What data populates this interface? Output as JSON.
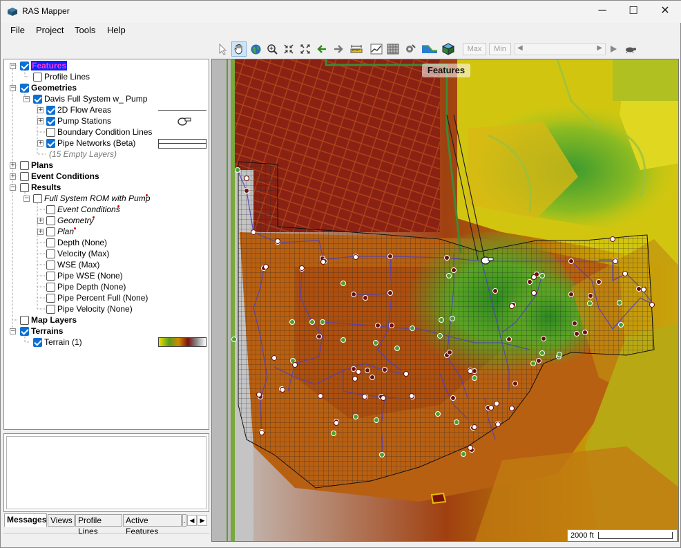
{
  "window": {
    "title": "RAS Mapper",
    "controls": {
      "minimize": "─",
      "maximize": "☐",
      "close": "✕"
    }
  },
  "menu": [
    "File",
    "Project",
    "Tools",
    "Help"
  ],
  "toolbar": {
    "max_label": "Max",
    "min_label": "Min",
    "icons": [
      "select-arrow-icon",
      "pan-hand-icon",
      "globe-icon",
      "zoom-in-icon",
      "zoom-extent-icon",
      "full-extent-icon",
      "back-arrow-icon",
      "forward-arrow-icon",
      "measure-ruler-icon",
      "profile-chart-icon",
      "raster-grid-icon",
      "tools-gear-icon",
      "terrain-profile-icon",
      "3d-cube-icon"
    ]
  },
  "tree": {
    "features": "Features",
    "profile_lines": "Profile Lines",
    "geometries": "Geometries",
    "geometry_name": "Davis Full System w_ Pump",
    "flow_areas": "2D Flow Areas",
    "pump_stations": "Pump Stations",
    "boundary_lines": "Boundary Condition Lines",
    "pipe_networks": "Pipe Networks (Beta)",
    "empty_layers": "(15 Empty Layers)",
    "plans": "Plans",
    "event_conditions": "Event Conditions",
    "results": "Results",
    "result_name": "Full System ROM with Pump",
    "r_event_conditions": "Event Conditions",
    "r_geometry": "Geometry",
    "r_plan": "Plan",
    "r_depth": "Depth (None)",
    "r_velocity": "Velocity (Max)",
    "r_wse": "WSE (Max)",
    "r_pipe_wse": "Pipe WSE (None)",
    "r_pipe_depth": "Pipe Depth (None)",
    "r_pipe_pct": "Pipe Percent Full (None)",
    "r_pipe_vel": "Pipe Velocity (None)",
    "map_layers": "Map Layers",
    "terrains": "Terrains",
    "terrain_item": "Terrain (1)"
  },
  "tabs": [
    "Messages",
    "Views",
    "Profile Lines",
    "Active Features",
    "."
  ],
  "map": {
    "title": "Features",
    "scale_label": "2000 ft",
    "terrain_colors": [
      "#f0d400",
      "#6fa32e",
      "#b36a10",
      "#7a1a14"
    ]
  }
}
